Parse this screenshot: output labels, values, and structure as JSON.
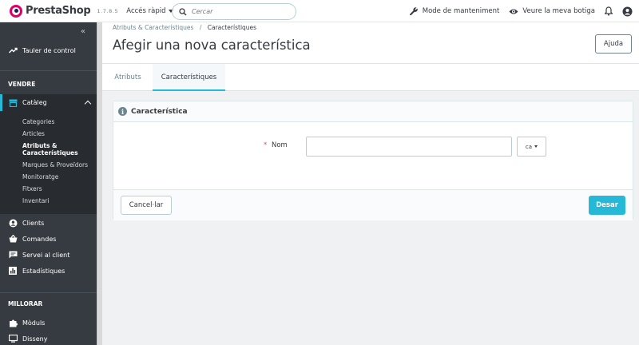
{
  "brand": {
    "name": "PrestaShop",
    "version": "1.7.8.5"
  },
  "header": {
    "quick_access": "Accés ràpid",
    "search_placeholder": "Cercar",
    "maintenance": "Mode de manteniment",
    "view_shop": "Veure la meva botiga"
  },
  "sidebar": {
    "dashboard": "Tauler de control",
    "section_sell": "VENDRE",
    "catalog": "Catàleg",
    "sub": [
      "Categories",
      "Articles",
      "Atributs &",
      "Característiques",
      "Marques & Proveïdors",
      "Monitoratge",
      "Fitxers",
      "Inventari"
    ],
    "clients": "Clients",
    "orders": "Comandes",
    "customer_service": "Servei al client",
    "stats": "Estadístiques",
    "section_improve": "MILLORAR",
    "modules": "Mòduls",
    "design": "Disseny"
  },
  "page": {
    "breadcrumb_parent": "Atributs & Característiques",
    "breadcrumb_sep": "/",
    "breadcrumb_current": "Característiques",
    "title": "Afegir una nova característica",
    "help": "Ajuda"
  },
  "tabs": [
    "Atributs",
    "Característiques"
  ],
  "form": {
    "panel_title": "Característica",
    "required_mark": "*",
    "name_label": "Nom",
    "name_value": "",
    "lang": "ca",
    "cancel": "Cancel·lar",
    "save": "Desar"
  },
  "colors": {
    "accent": "#25b9d7",
    "sidebar": "#363a41",
    "brand": "#df0067"
  }
}
